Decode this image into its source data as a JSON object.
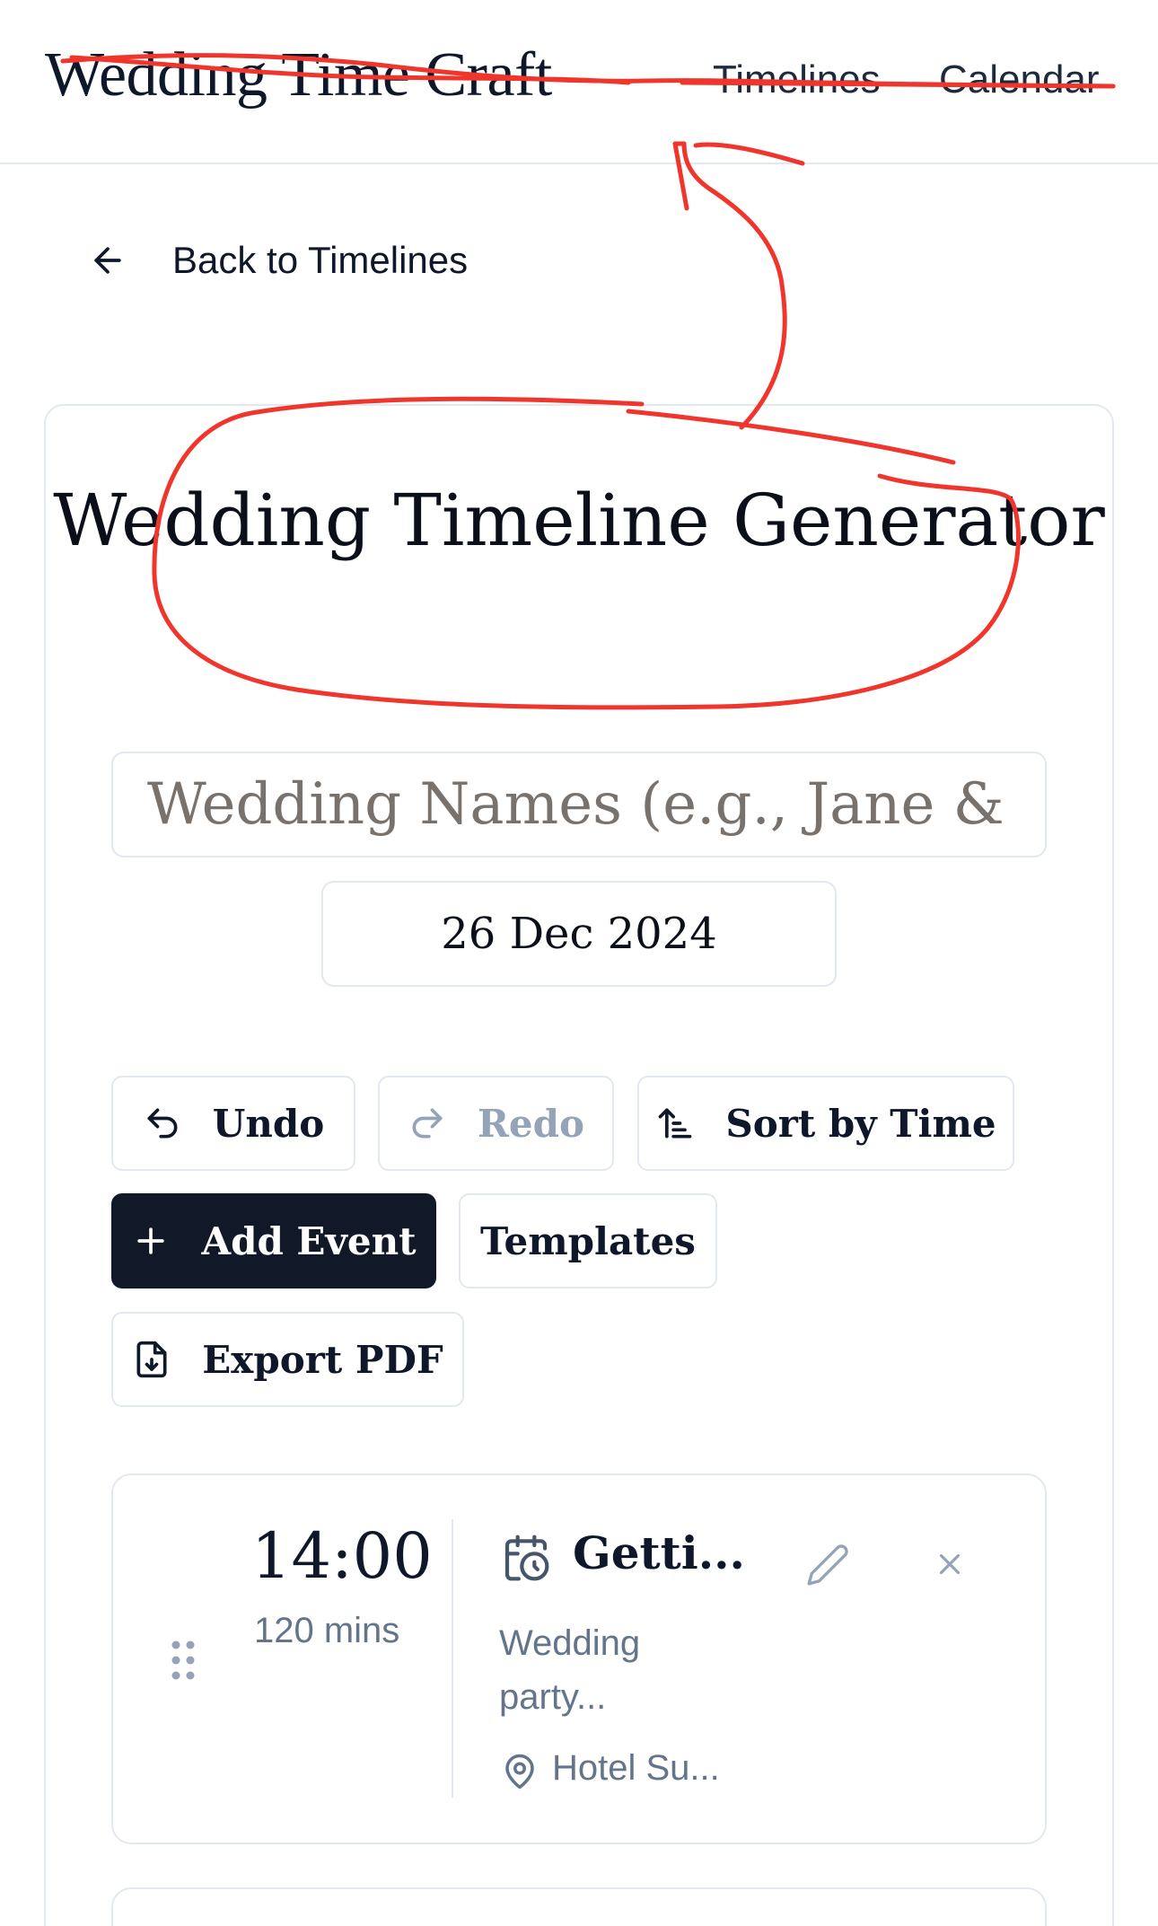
{
  "header": {
    "brand": "Wedding Time Craft",
    "nav": {
      "timelines": "Timelines",
      "calendar": "Calendar"
    }
  },
  "back_link": {
    "label": "Back to Timelines",
    "icon": "arrow-left-icon"
  },
  "generator": {
    "title": "Wedding Timeline Generator",
    "names_placeholder": "Wedding Names (e.g., Jane & John)",
    "names_value": "",
    "date": "26 Dec 2024"
  },
  "toolbar": {
    "undo": "Undo",
    "redo": "Redo",
    "sort": "Sort by Time",
    "add_event": "Add Event",
    "templates": "Templates",
    "export_pdf": "Export PDF"
  },
  "events": [
    {
      "time": "14:00",
      "duration": "120 mins",
      "title": "Getti...",
      "description": "Wedding party...",
      "location": "Hotel Su..."
    }
  ],
  "colors": {
    "accent_dark": "#111827",
    "border": "#e2e8f0",
    "muted_text": "#64748b",
    "annotation_red": "#f0362c"
  }
}
